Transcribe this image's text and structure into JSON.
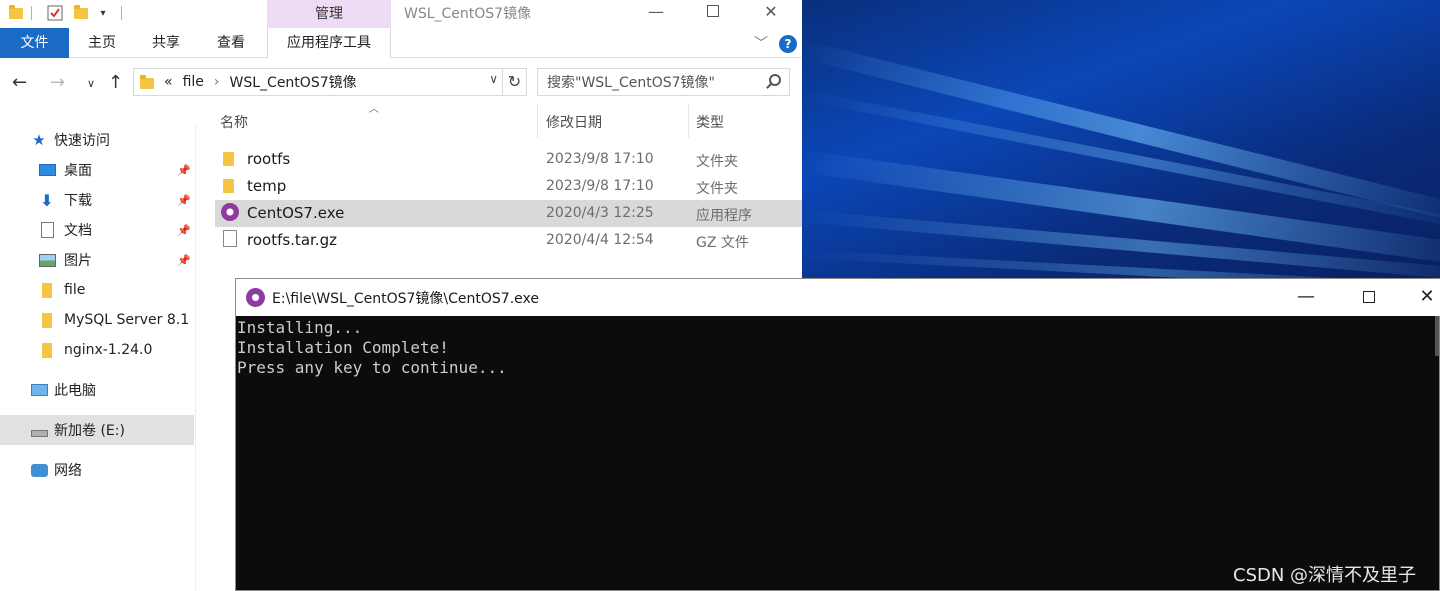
{
  "explorer": {
    "title": "WSL_CentOS7镜像",
    "context_tab": "管理",
    "ribbon_tabs": {
      "file": "文件",
      "home": "主页",
      "share": "共享",
      "view": "查看",
      "app_tools": "应用程序工具"
    },
    "address": {
      "prefix": "«",
      "crumb_1": "file",
      "separator": "›",
      "crumb_2": "WSL_CentOS7镜像"
    },
    "search_placeholder": "搜索\"WSL_CentOS7镜像\"",
    "columns": {
      "name": "名称",
      "modified": "修改日期",
      "type": "类型"
    },
    "files": [
      {
        "name": "rootfs",
        "modified": "2023/9/8 17:10",
        "type": "文件夹",
        "icon": "folder-icon"
      },
      {
        "name": "temp",
        "modified": "2023/9/8 17:10",
        "type": "文件夹",
        "icon": "folder-icon"
      },
      {
        "name": "CentOS7.exe",
        "modified": "2020/4/3 12:25",
        "type": "应用程序",
        "icon": "exe-icon",
        "selected": true
      },
      {
        "name": "rootfs.tar.gz",
        "modified": "2020/4/4 12:54",
        "type": "GZ 文件",
        "icon": "file-icon"
      }
    ],
    "sidebar": {
      "quick_access": "快速访问",
      "items": [
        {
          "label": "桌面",
          "icon": "desktop-icon",
          "pinned": true
        },
        {
          "label": "下载",
          "icon": "download-icon",
          "pinned": true
        },
        {
          "label": "文档",
          "icon": "document-icon",
          "pinned": true
        },
        {
          "label": "图片",
          "icon": "picture-icon",
          "pinned": true
        },
        {
          "label": "file",
          "icon": "folder-icon"
        },
        {
          "label": "MySQL Server 8.1",
          "icon": "folder-icon"
        },
        {
          "label": "nginx-1.24.0",
          "icon": "folder-icon"
        }
      ],
      "this_pc": "此电脑",
      "drive": "新加卷 (E:)",
      "network": "网络"
    }
  },
  "console": {
    "title": "E:\\file\\WSL_CentOS7镜像\\CentOS7.exe",
    "lines": [
      "Installing...",
      "Installation Complete!",
      "Press any key to continue..."
    ]
  },
  "watermark": "CSDN @深情不及里子",
  "colors": {
    "ribbon_file_tab": "#1a6bc4",
    "manage_tab": "#eedcf4",
    "console_bg": "#0c0c0c",
    "console_text": "#cccccc"
  }
}
